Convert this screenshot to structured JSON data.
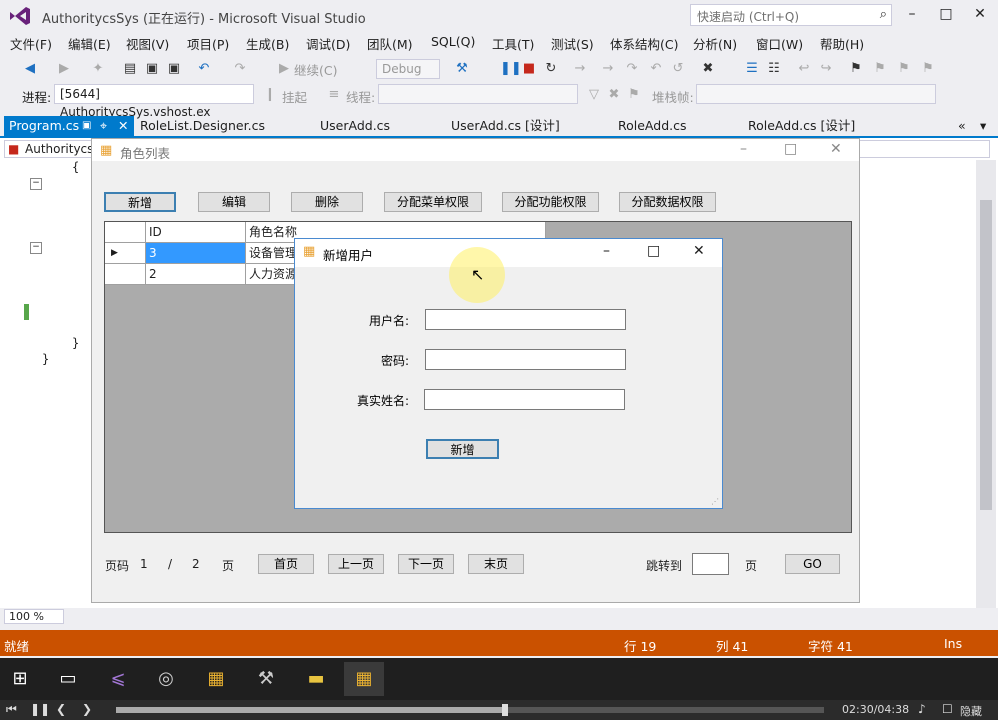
{
  "vs": {
    "title": "AuthoritycsSys (正在运行) - Microsoft Visual Studio",
    "quick_launch_placeholder": "快速启动 (Ctrl+Q)",
    "menu": [
      "文件(F)",
      "编辑(E)",
      "视图(V)",
      "项目(P)",
      "生成(B)",
      "调试(D)",
      "团队(M)",
      "SQL(Q)",
      "工具(T)",
      "测试(S)",
      "体系结构(C)",
      "分析(N)",
      "窗口(W)",
      "帮助(H)"
    ],
    "toolbar": {
      "continue_label": "继续(C)",
      "config": "Debug",
      "process_label": "进程:",
      "process_value": "[5644] AuthoritycsSys.vshost.ex",
      "suspend_label": "挂起",
      "thread_label": "线程:",
      "stackframe_label": "堆栈帧:"
    },
    "tabs": [
      "Program.cs",
      "RoleList.Designer.cs",
      "UserAdd.cs",
      "UserAdd.cs [设计]",
      "RoleAdd.cs",
      "RoleAdd.cs [设计]"
    ],
    "nav_combo": "Authoritycs",
    "code_lines": [
      "{",
      "}",
      "}"
    ],
    "zoom": "100 %",
    "status": {
      "ready": "就绪",
      "line": "行 19",
      "col": "列 41",
      "char": "字符 41",
      "mode": "Ins"
    }
  },
  "role_form": {
    "title": "角色列表",
    "buttons": [
      "新增",
      "编辑",
      "删除",
      "分配菜单权限",
      "分配功能权限",
      "分配数据权限"
    ],
    "grid": {
      "headers": [
        "ID",
        "角色名称"
      ],
      "rows": [
        [
          "3",
          "设备管理"
        ],
        [
          "2",
          "人力资源"
        ]
      ]
    },
    "pager": {
      "page_label": "页码",
      "current": "1",
      "separator": "/",
      "total": "2",
      "page_unit": "页",
      "first": "首页",
      "prev": "上一页",
      "next": "下一页",
      "last": "末页",
      "jump_label": "跳转到",
      "jump_unit": "页",
      "go": "GO"
    }
  },
  "user_dialog": {
    "title": "新增用户",
    "username_label": "用户名:",
    "password_label": "密码:",
    "realname_label": "真实姓名:",
    "username_value": "",
    "password_value": "",
    "realname_value": "",
    "submit": "新增"
  },
  "player": {
    "time": "02:30/04:38",
    "hide": "隐藏",
    "progress": 0.55
  },
  "colors": {
    "accent": "#007acc",
    "statusbar": "#ca5100",
    "selection": "#3399ff"
  }
}
